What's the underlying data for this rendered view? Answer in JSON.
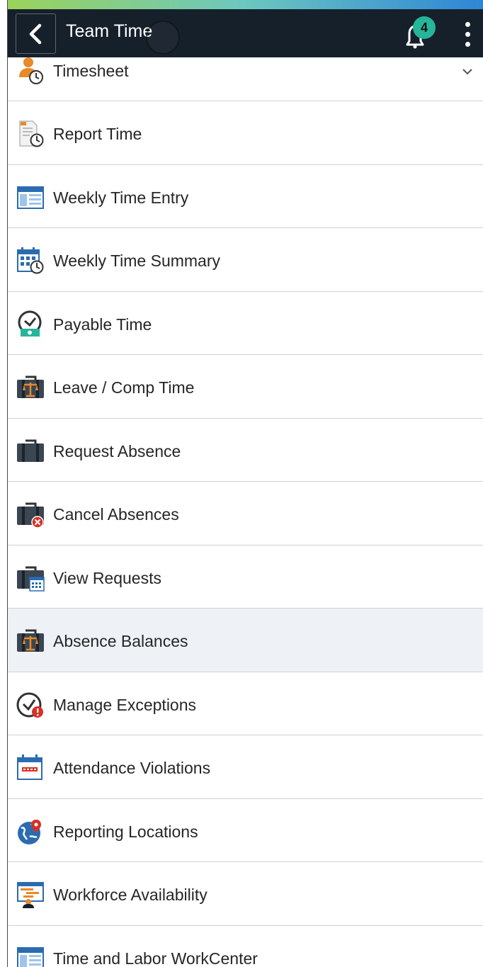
{
  "header": {
    "title": "Team Time",
    "notification_count": "4"
  },
  "menu": {
    "items": [
      {
        "label": "Timesheet",
        "icon": "timesheet-person-clock-icon"
      },
      {
        "label": "Report Time",
        "icon": "report-time-document-icon"
      },
      {
        "label": "Weekly Time Entry",
        "icon": "weekly-entry-window-icon"
      },
      {
        "label": "Weekly Time Summary",
        "icon": "calendar-clock-icon"
      },
      {
        "label": "Payable Time",
        "icon": "payable-clock-money-icon"
      },
      {
        "label": "Leave / Comp Time",
        "icon": "briefcase-scales-icon"
      },
      {
        "label": "Request Absence",
        "icon": "briefcase-icon"
      },
      {
        "label": "Cancel Absences",
        "icon": "briefcase-cancel-icon"
      },
      {
        "label": "View Requests",
        "icon": "briefcase-calendar-icon"
      },
      {
        "label": "Absence Balances",
        "icon": "briefcase-scales-icon"
      },
      {
        "label": "Manage Exceptions",
        "icon": "clock-alert-icon"
      },
      {
        "label": "Attendance Violations",
        "icon": "calendar-violation-icon"
      },
      {
        "label": "Reporting Locations",
        "icon": "globe-pin-icon"
      },
      {
        "label": "Workforce Availability",
        "icon": "workforce-availability-icon"
      },
      {
        "label": "Time and Labor WorkCenter",
        "icon": "workcenter-window-icon"
      }
    ],
    "active_index": 9
  },
  "colors": {
    "header_bg": "#16202b",
    "badge": "#26b49a",
    "active_row": "#eef2f7",
    "icon_blue": "#2b6cb0",
    "icon_orange": "#e8892b"
  }
}
